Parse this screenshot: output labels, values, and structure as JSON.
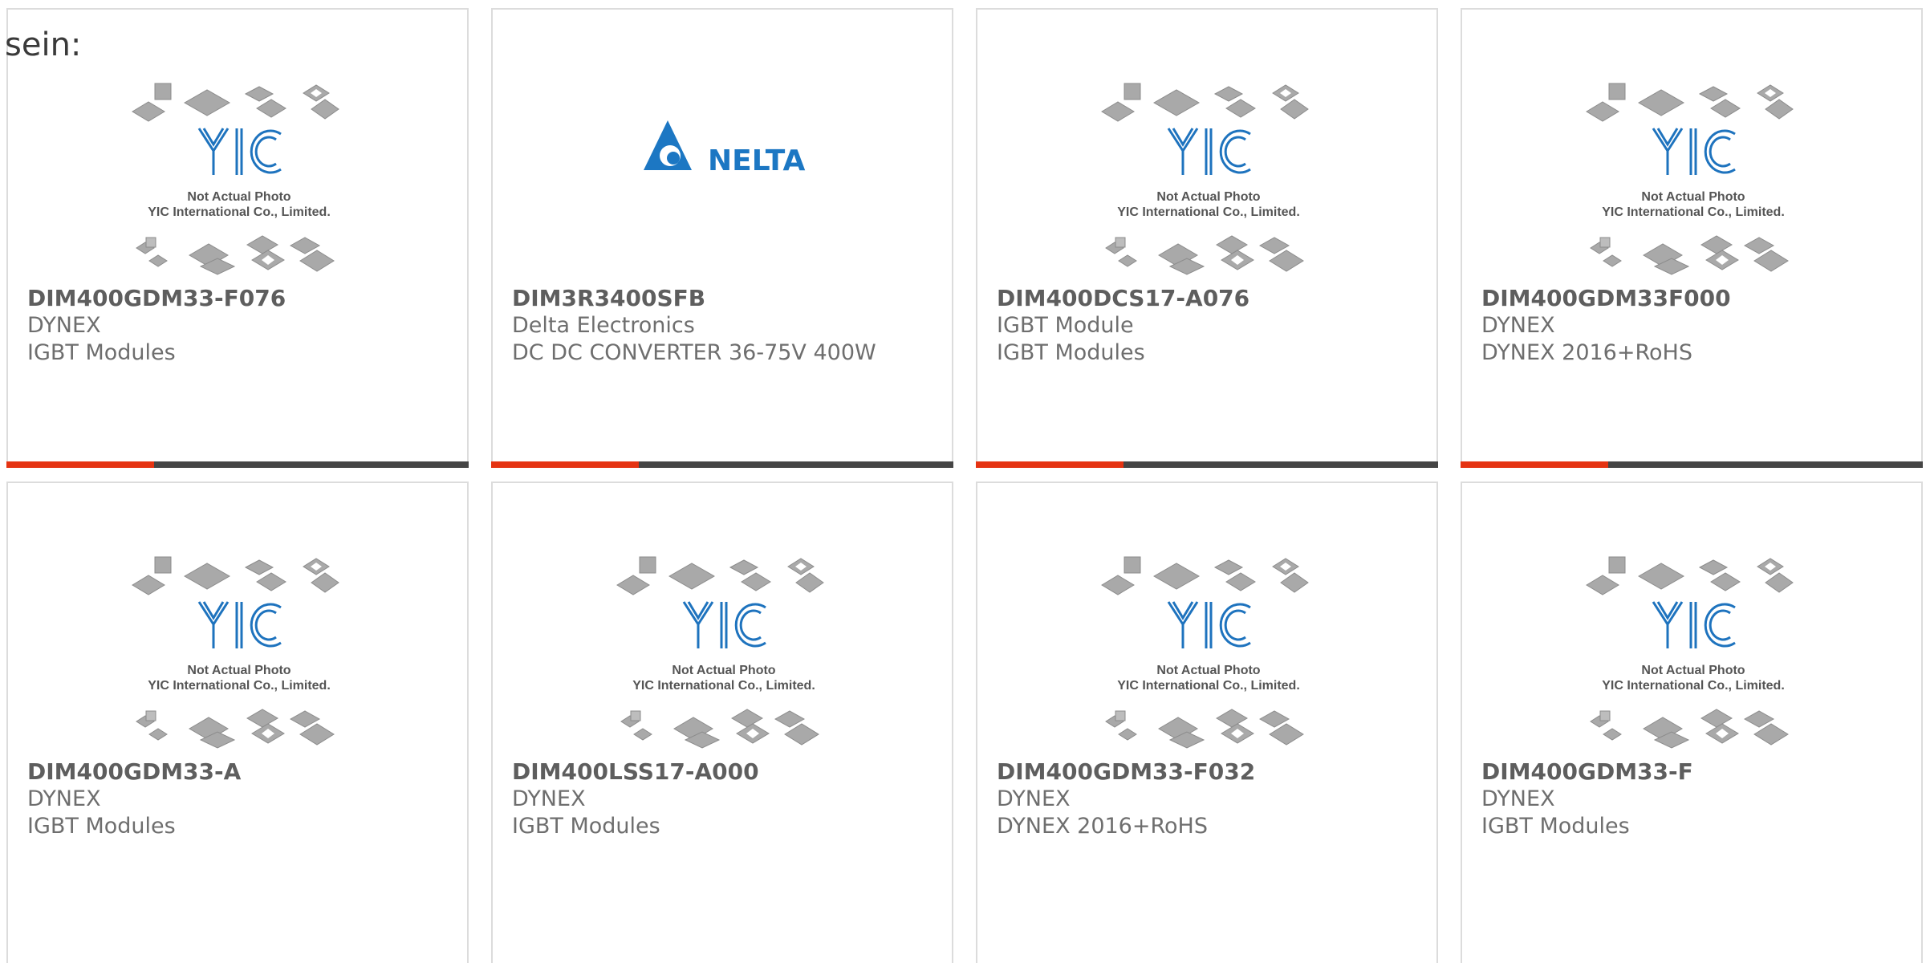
{
  "lead_text": "sein:",
  "placeholder": {
    "caption_line1": "Not Actual Photo",
    "caption_line2": "YIC International Co., Limited.",
    "logo_text": "YIC"
  },
  "delta_logo_text": "NELTA",
  "colors": {
    "accent": "#e53312",
    "bar_dark": "#454545",
    "yic_blue": "#1e73be",
    "delta_blue": "#1c77c3"
  },
  "products": [
    {
      "part": "DIM400GDM33-F076",
      "maker": "DYNEX",
      "desc": "IGBT Modules",
      "image": "yic-placeholder"
    },
    {
      "part": "DIM3R3400SFB",
      "maker": "Delta Electronics",
      "desc": "DC DC CONVERTER 36-75V 400W",
      "image": "delta-logo"
    },
    {
      "part": "DIM400DCS17-A076",
      "maker": "IGBT Module",
      "desc": "IGBT Modules",
      "image": "yic-placeholder"
    },
    {
      "part": "DIM400GDM33F000",
      "maker": "DYNEX",
      "desc": "DYNEX 2016+RoHS",
      "image": "yic-placeholder"
    },
    {
      "part": "DIM400GDM33-A",
      "maker": "DYNEX",
      "desc": "IGBT Modules",
      "image": "yic-placeholder"
    },
    {
      "part": "DIM400LSS17-A000",
      "maker": "DYNEX",
      "desc": "IGBT Modules",
      "image": "yic-placeholder"
    },
    {
      "part": "DIM400GDM33-F032",
      "maker": "DYNEX",
      "desc": "DYNEX 2016+RoHS",
      "image": "yic-placeholder"
    },
    {
      "part": "DIM400GDM33-F",
      "maker": "DYNEX",
      "desc": "IGBT Modules",
      "image": "yic-placeholder"
    }
  ]
}
